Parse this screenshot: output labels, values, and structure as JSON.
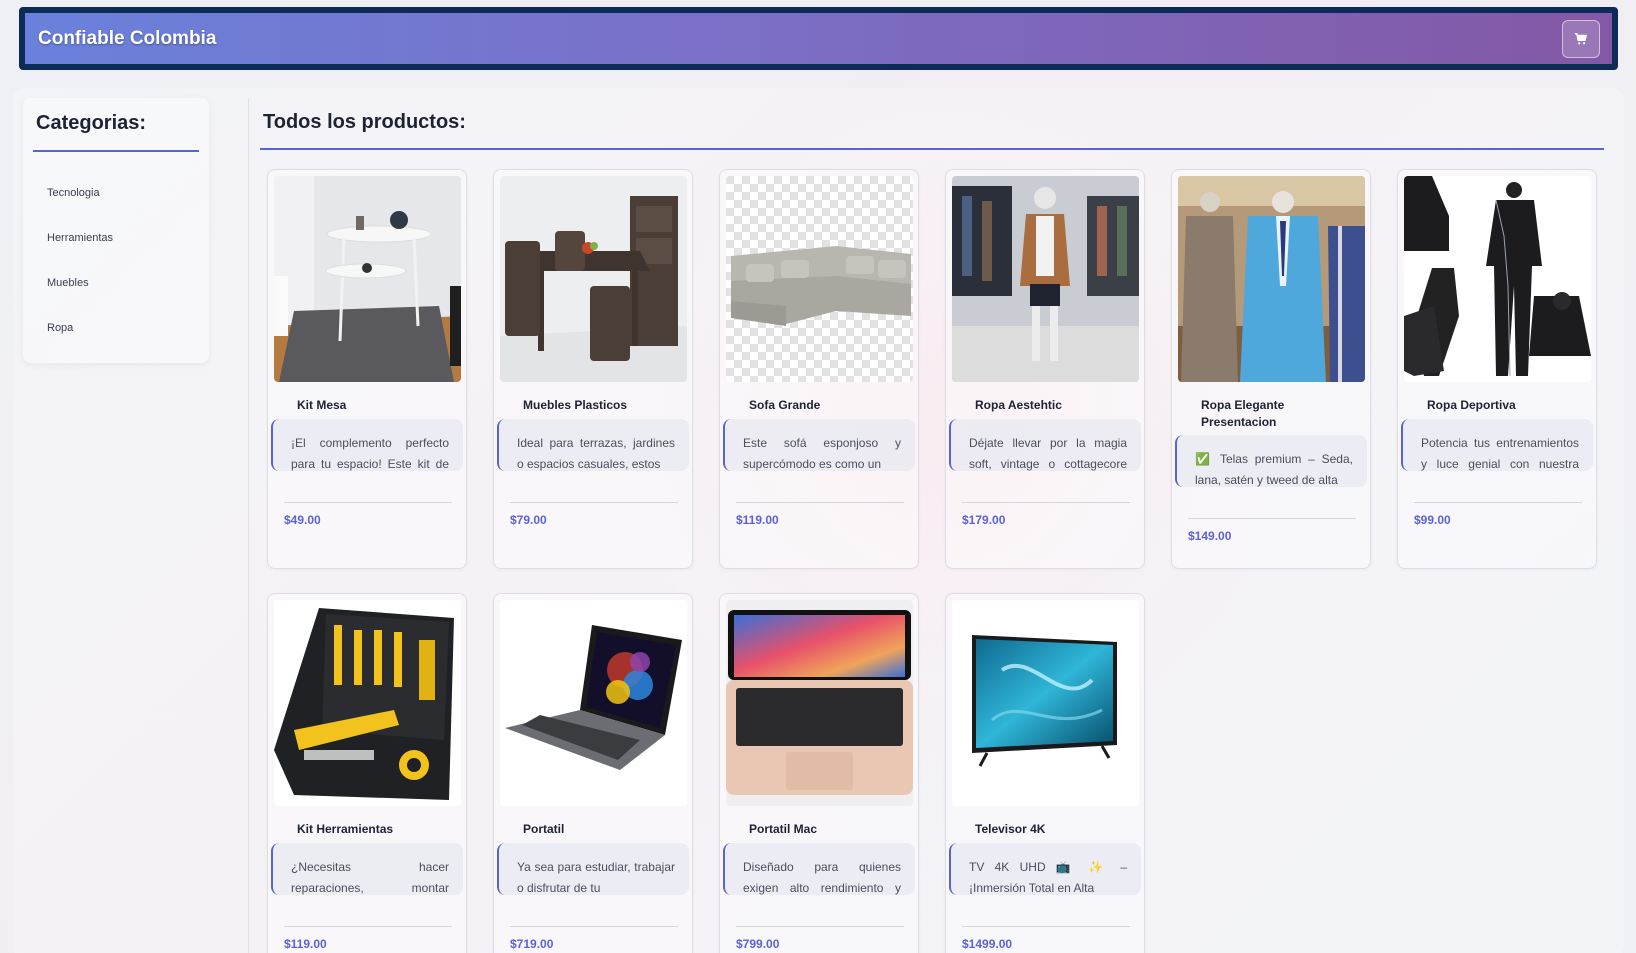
{
  "header": {
    "brand": "Confiable Colombia",
    "cart_icon": "cart-icon"
  },
  "sidebar": {
    "title": "Categorias:",
    "categories": [
      "Tecnologia",
      "Herramientas",
      "Muebles",
      "Ropa"
    ]
  },
  "main": {
    "title": "Todos los productos:"
  },
  "colors": {
    "accent": "#5a63d6",
    "header_border": "#0d2b57",
    "header_start": "#6a81db",
    "header_end": "#8458a6"
  },
  "products": [
    {
      "name": "Kit Mesa",
      "desc": "¡El complemento perfecto para tu espacio! Este kit de mesita",
      "price": "$49.00",
      "image": "mesa"
    },
    {
      "name": "Muebles Plasticos",
      "desc": "Ideal para terrazas, jardines o espacios casuales, estos",
      "price": "$79.00",
      "image": "muebles"
    },
    {
      "name": "Sofa Grande",
      "desc": "Este sofá esponjoso y supercómodo es como un",
      "price": "$119.00",
      "image": "sofa"
    },
    {
      "name": "Ropa Aestehtic",
      "desc": "Déjate llevar por la magia soft, vintage o cottagecore con",
      "price": "$179.00",
      "image": "aesthetic"
    },
    {
      "name": "Ropa Elegante Presentacion",
      "desc": "✅ Telas premium – Seda, lana, satén y tweed de alta",
      "price": "$149.00",
      "image": "elegante"
    },
    {
      "name": "Ropa Deportiva",
      "desc": "Potencia tus entrenamientos y luce genial con nuestra ropa",
      "price": "$99.00",
      "image": "deportiva"
    },
    {
      "name": "Kit Herramientas",
      "desc": "¿Necesitas hacer reparaciones, montar muebles",
      "price": "$119.00",
      "image": "herramientas"
    },
    {
      "name": "Portatil",
      "desc": "Ya sea para estudiar, trabajar o disfrutar de tu",
      "price": "$719.00",
      "image": "portatil"
    },
    {
      "name": "Portatil Mac",
      "desc": "Diseñado para quienes exigen alto rendimiento y estilo",
      "price": "$799.00",
      "image": "mac"
    },
    {
      "name": "Televisor 4K",
      "desc": "TV 4K UHD 📺 ✨ – ¡Inmersión Total en Alta",
      "price": "$1499.00",
      "image": "tv"
    }
  ]
}
